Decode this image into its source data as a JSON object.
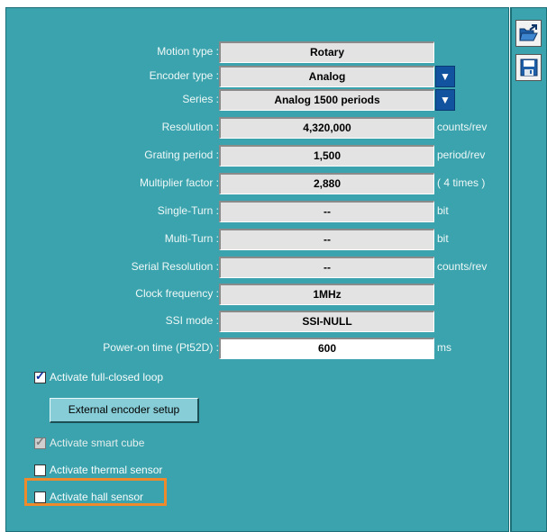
{
  "fields": [
    {
      "label": "Motion type :",
      "value": "Rotary",
      "unit": ""
    },
    {
      "label": "Encoder type :",
      "value": "Analog",
      "unit": ""
    },
    {
      "label": "Series :",
      "value": "Analog 1500 periods",
      "unit": ""
    },
    {
      "label": "Resolution :",
      "value": "4,320,000",
      "unit": "counts/rev"
    },
    {
      "label": "Grating period :",
      "value": "1,500",
      "unit": "period/rev"
    },
    {
      "label": "Multiplier factor :",
      "value": "2,880",
      "unit": "( 4 times )"
    },
    {
      "label": "Single-Turn :",
      "value": "--",
      "unit": "bit"
    },
    {
      "label": "Multi-Turn :",
      "value": "--",
      "unit": "bit"
    },
    {
      "label": "Serial Resolution :",
      "value": "--",
      "unit": "counts/rev"
    },
    {
      "label": "Clock frequency :",
      "value": "1MHz",
      "unit": ""
    },
    {
      "label": "SSI mode :",
      "value": "SSI-NULL",
      "unit": ""
    },
    {
      "label": "Power-on time (Pt52D) :",
      "value": "600",
      "unit": "ms"
    }
  ],
  "dropdown_arrow": "▼",
  "checks": {
    "full_closed_loop": {
      "label": "Activate full-closed loop",
      "checked": true
    },
    "smart_cube": {
      "label": "Activate smart cube",
      "checked": true,
      "disabled": true
    },
    "thermal_sensor": {
      "label": "Activate thermal sensor",
      "checked": false
    },
    "hall_sensor": {
      "label": "Activate hall sensor",
      "checked": false
    }
  },
  "external_encoder_button": "External encoder setup",
  "tools": {
    "open_icon": "folder-open-icon",
    "save_icon": "save-disk-icon"
  },
  "colors": {
    "panel": "#3aa3ad",
    "dropdown": "#12539f",
    "highlight": "#ef8a2c",
    "button": "#87cdd7"
  }
}
